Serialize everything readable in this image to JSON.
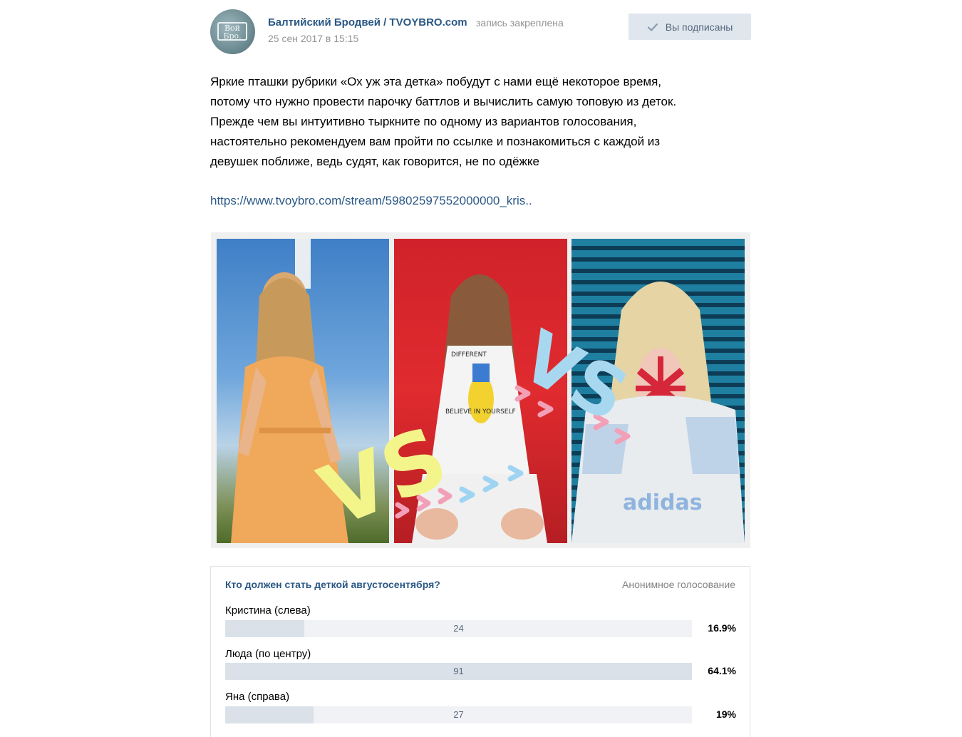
{
  "header": {
    "author": "Балтийский Бродвей / TVOYBRO.com",
    "pinned": "запись закреплена",
    "date": "25 сен 2017 в 15:15",
    "avatar_text_1": "Вой",
    "avatar_text_2": "Бро.",
    "subscribe_label": "Вы подписаны",
    "subscribe_icon": "check-icon"
  },
  "post": {
    "text_lines": [
      "Яркие пташки рубрики «Ох уж эта детка» побудут с нами ещё некоторое время,",
      "потому что нужно провести парочку баттлов и вычислить самую топовую из деток.",
      "Прежде чем вы интуитивно тыркните по одному из вариантов голосования,",
      "настоятельно рекомендуем вам пройти по ссылке и познакомиться с каждой из",
      "девушек поближе, ведь судят, как говорится, не по одёжке"
    ],
    "link": "https://www.tvoybro.com/stream/59802597552000000_kris.."
  },
  "photo": {
    "vs_text": "VS",
    "shirt_text_1": "DIFFERENT",
    "shirt_text_2": "BELIEVE IN YOURSELF",
    "brand_text": "adidas",
    "colors": {
      "vs_yellow": "#f3f58a",
      "vs_blue": "#a8d8f0",
      "arrow_pink": "#f2a0b8",
      "arrow_blue": "#9ed4f2"
    }
  },
  "poll": {
    "question": "Кто должен стать деткой августосентября?",
    "type": "Анонимное голосование",
    "options": [
      {
        "label": "Кристина (слева)",
        "count": "24",
        "percent": "16.9%",
        "fraction": 0.169
      },
      {
        "label": "Люда (по центру)",
        "count": "91",
        "percent": "64.1%",
        "fraction": 1.0
      },
      {
        "label": "Яна (справа)",
        "count": "27",
        "percent": "19%",
        "fraction": 0.19
      }
    ]
  },
  "colors": {
    "link": "#2a5885",
    "meta": "#939393",
    "button_bg": "#dfe6ed",
    "bar_bg": "#f0f2f5",
    "bar_fill": "#dae1e8"
  }
}
